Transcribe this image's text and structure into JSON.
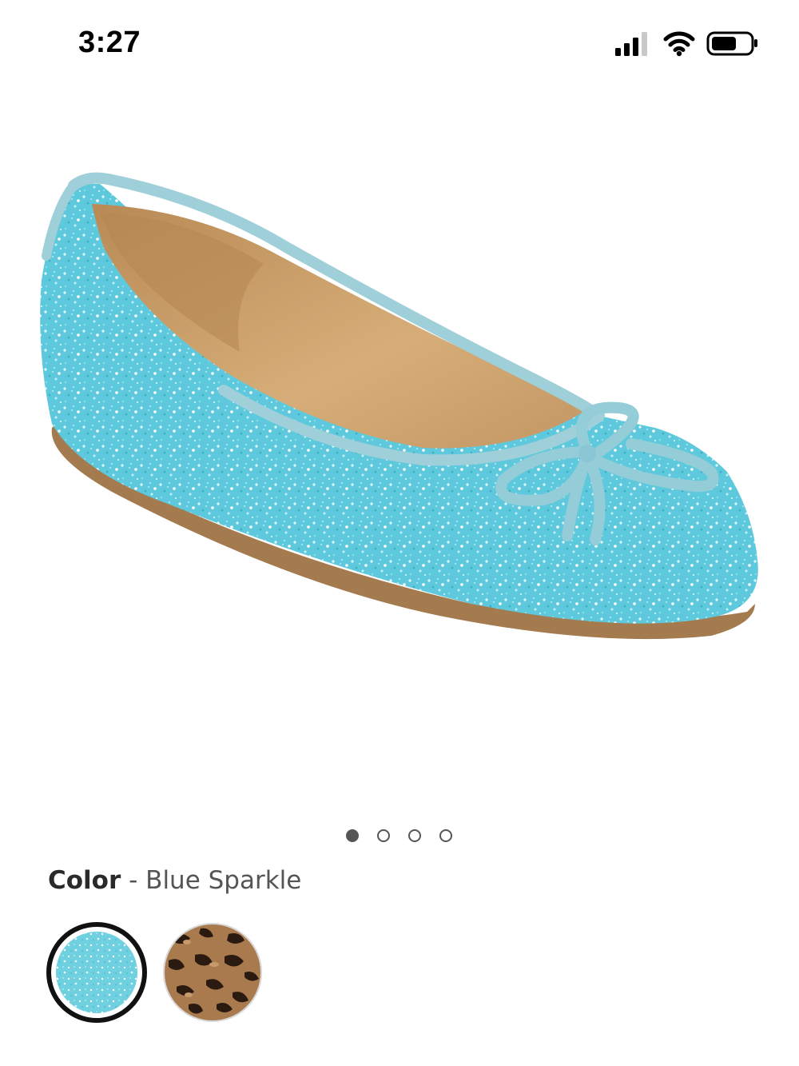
{
  "status_bar": {
    "time": "3:27",
    "icons": [
      "signal-icon",
      "wifi-icon",
      "battery-icon"
    ]
  },
  "product": {
    "image_alt": "Blue glitter ballet flat with bow",
    "colors": {
      "glitter": "#5ec9dc",
      "trim": "#9fcfd8",
      "insole": "#c9a06e",
      "sole": "#a47a4f"
    }
  },
  "carousel": {
    "total": 4,
    "active_index": 0
  },
  "color_selector": {
    "label": "Color",
    "separator": "-",
    "selected_value": "Blue Sparkle",
    "swatches": [
      {
        "name": "Blue Sparkle",
        "selected": true,
        "color": "#6fd0e0"
      },
      {
        "name": "Leopard",
        "selected": false,
        "color": "#a97a4e"
      }
    ]
  }
}
